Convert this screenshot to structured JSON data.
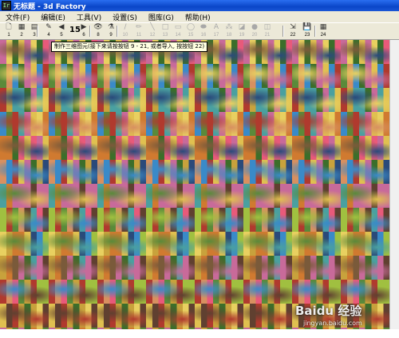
{
  "window": {
    "title": "无标题 - 3d Factory",
    "app_icon": "Ir"
  },
  "menu": [
    "文件(F)",
    "编辑(E)",
    "工具(V)",
    "设置(S)",
    "图库(G)",
    "帮助(H)"
  ],
  "toolbar": {
    "buttons": [
      {
        "icon": "new-file-icon",
        "glyph": "🗋",
        "num": "1"
      },
      {
        "icon": "grid-icon",
        "glyph": "▦",
        "num": "2"
      },
      {
        "icon": "layers-icon",
        "glyph": "▤",
        "num": "3"
      },
      {
        "icon": "pen-icon",
        "glyph": "✎",
        "num": "4"
      },
      {
        "icon": "arrow-left-icon",
        "glyph": "◀",
        "num": "5"
      },
      {
        "icon": "arrow-right-icon",
        "glyph": "▶",
        "num": "6"
      },
      {
        "icon": "eye-icon",
        "glyph": "👁",
        "num": "8"
      },
      {
        "icon": "filter-icon",
        "glyph": "⚗",
        "num": "9"
      },
      {
        "icon": "brush-icon",
        "glyph": "/",
        "num": "10"
      },
      {
        "icon": "pencil-icon",
        "glyph": "✏",
        "num": "11"
      },
      {
        "icon": "line-icon",
        "glyph": "╲",
        "num": "12"
      },
      {
        "icon": "rect-icon",
        "glyph": "□",
        "num": "13"
      },
      {
        "icon": "rect-fill-icon",
        "glyph": "▭",
        "num": "14"
      },
      {
        "icon": "ellipse-icon",
        "glyph": "◯",
        "num": "15"
      },
      {
        "icon": "ellipse-fill-icon",
        "glyph": "⬬",
        "num": "16"
      },
      {
        "icon": "text-icon",
        "glyph": "A",
        "num": "17"
      },
      {
        "icon": "spray-icon",
        "glyph": "⁂",
        "num": "18"
      },
      {
        "icon": "fill-icon",
        "glyph": "◪",
        "num": "19"
      },
      {
        "icon": "circle-fill-icon",
        "glyph": "●",
        "num": "20"
      },
      {
        "icon": "gradient-icon",
        "glyph": "◫",
        "num": "21"
      },
      {
        "icon": "import-icon",
        "glyph": "⇲",
        "num": "22"
      },
      {
        "icon": "save-icon",
        "glyph": "💾",
        "num": "23"
      },
      {
        "icon": "grid-large-icon",
        "glyph": "▦",
        "num": "24"
      }
    ],
    "number_display": "15"
  },
  "tooltip": "制作三维图元(接下来请按按钮 9 - 21, 或者导入, 按按钮 22)",
  "watermark": {
    "logo": "Baidu 经验",
    "url": "jingyan.baidu.com"
  }
}
